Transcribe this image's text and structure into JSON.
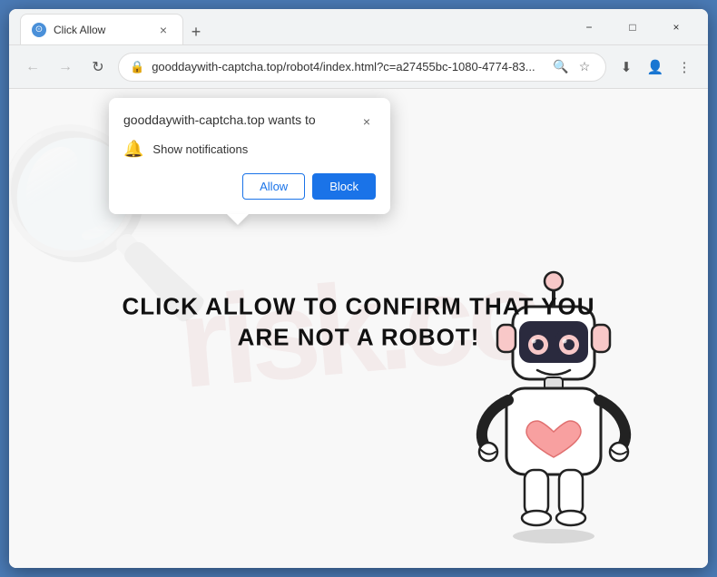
{
  "window": {
    "title": "Click Allow",
    "tab_close": "×",
    "new_tab": "+"
  },
  "titlebar": {
    "favicon": "⊙",
    "tab_label": "Click Allow",
    "minimize": "−",
    "maximize": "□",
    "close": "×"
  },
  "addressbar": {
    "back": "←",
    "forward": "→",
    "reload": "↻",
    "url": "gooddaywith-captcha.top/robot4/index.html?c=a27455bc-1080-4774-83...",
    "lock_icon": "🔒",
    "search_icon": "🔍",
    "star_icon": "☆",
    "profile_icon": "👤",
    "menu_icon": "⋮",
    "download_icon": "⬇"
  },
  "popup": {
    "title": "gooddaywith-captcha.top wants to",
    "close_btn": "×",
    "notification_icon": "🔔",
    "notification_text": "Show notifications",
    "allow_label": "Allow",
    "block_label": "Block"
  },
  "page": {
    "main_text_line1": "CLICK ALLOW TO CONFIRM THAT YOU",
    "main_text_line2": "ARE NOT A ROBOT!",
    "watermark": "risk.co"
  }
}
